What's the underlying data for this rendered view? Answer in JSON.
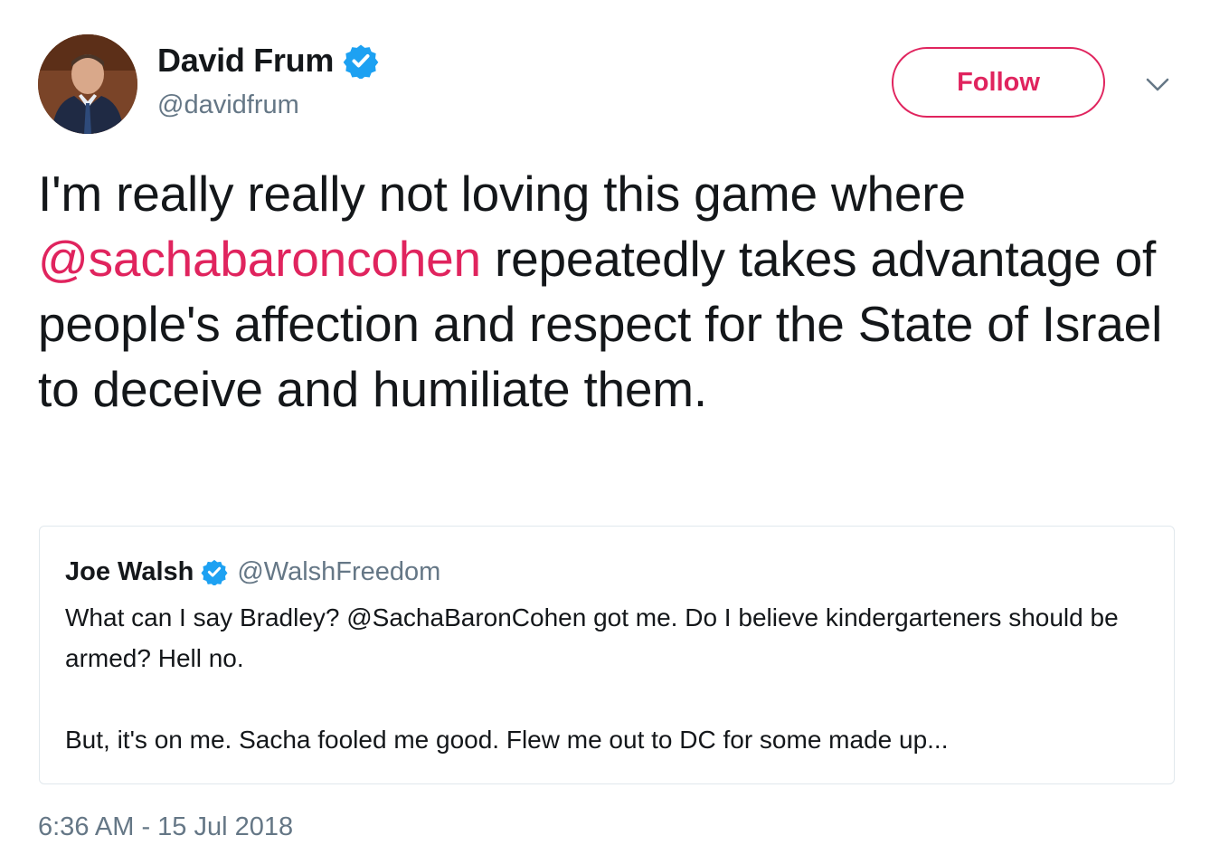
{
  "author": {
    "name": "David Frum",
    "handle": "@davidfrum",
    "verified": true,
    "avatar_icon": "profile-photo"
  },
  "follow_button": {
    "label": "Follow"
  },
  "menu": {
    "icon": "chevron-down-icon"
  },
  "tweet": {
    "text_before": "I'm really really not loving this game where ",
    "mention": "@sachabaroncohen",
    "text_after": " repeatedly takes advantage of people's affection and respect for the State of Israel to deceive and humiliate them."
  },
  "quoted_tweet": {
    "name": "Joe Walsh",
    "handle": "@WalshFreedom",
    "verified": true,
    "paragraph_1": "What can I say Bradley? @SachaBaronCohen got me. Do I believe kindergarteners should be armed? Hell no.",
    "paragraph_2": "But, it's on me. Sacha fooled me good. Flew me out to DC for some made up..."
  },
  "timestamp": "6:36 AM - 15 Jul 2018",
  "colors": {
    "accent": "#e0245e",
    "verified_blue": "#1da1f2",
    "secondary_text": "#657786",
    "border": "#e1e8ed"
  }
}
